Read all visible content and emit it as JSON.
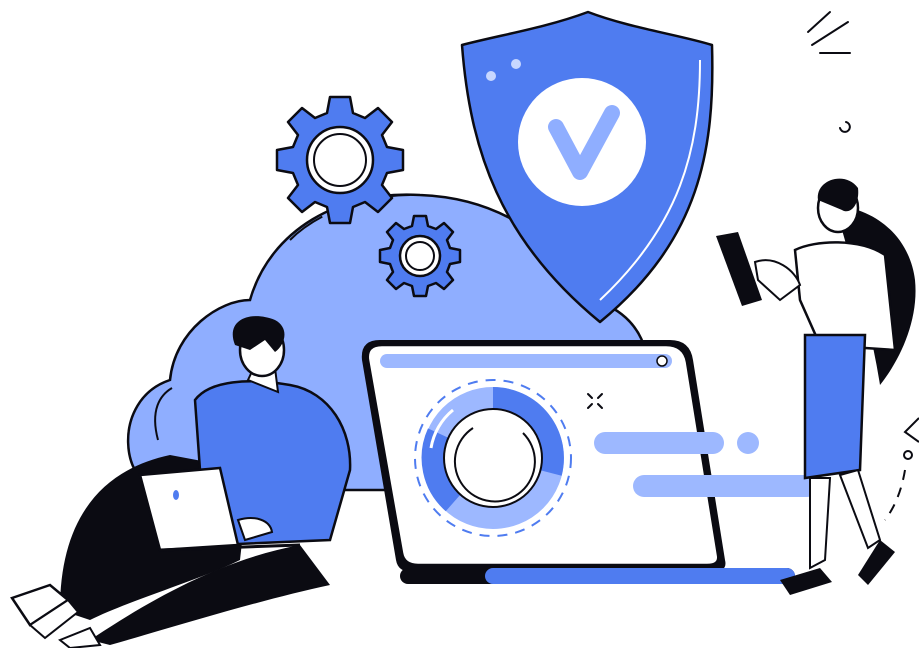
{
  "illustration": {
    "subject": "cloud-security-dashboard",
    "palette": {
      "primary_blue": "#4F7CF0",
      "light_blue": "#9DB8FF",
      "pale_blue": "#C8D7FF",
      "outline": "#0B0B12",
      "white": "#FFFFFF"
    },
    "icons": [
      "shield-check-icon",
      "gear-icon",
      "cloud-icon",
      "dashboard-screen-icon",
      "laptop-icon",
      "tablet-icon",
      "donut-progress-icon",
      "sparkle-icon"
    ],
    "people": [
      "man-with-laptop",
      "woman-with-tablet"
    ]
  }
}
